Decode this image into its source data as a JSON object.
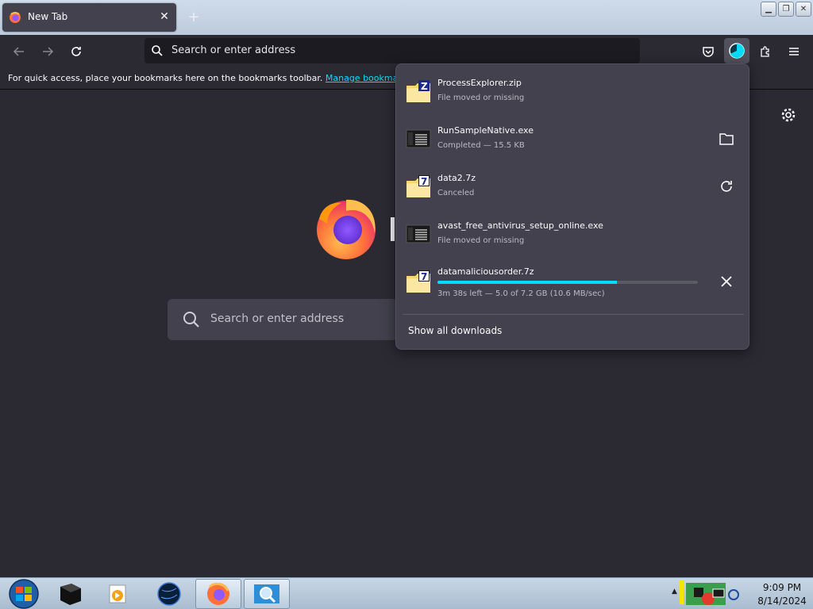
{
  "tab": {
    "title": "New Tab",
    "close_glyph": "✕"
  },
  "toolbar": {
    "new_tab_glyph": "+",
    "url_placeholder": "Search or enter address"
  },
  "bookmarks_bar": {
    "message": "For quick access, place your bookmarks here on the bookmarks toolbar.",
    "link": "Manage bookmarks…"
  },
  "new_tab_page": {
    "search_placeholder": "Search or enter address"
  },
  "downloads": {
    "items": [
      {
        "name": "ProcessExplorer.zip",
        "status": "File moved or missing",
        "icon": "zip-archive-icon",
        "action": ""
      },
      {
        "name": "RunSampleNative.exe",
        "status": "Completed — 15.5 KB",
        "icon": "executable-icon",
        "action": "folder-icon"
      },
      {
        "name": "data2.7z",
        "status": "Canceled",
        "icon": "7z-archive-icon",
        "action": "retry-icon"
      },
      {
        "name": "avast_free_antivirus_setup_online.exe",
        "status": "File moved or missing",
        "icon": "executable-icon",
        "action": ""
      },
      {
        "name": "datamaliciousorder.7z",
        "status": "3m 38s left — 5.0 of 7.2 GB (10.6 MB/sec)",
        "icon": "7z-archive-icon",
        "action": "cancel-icon",
        "progress": 0.69
      }
    ],
    "show_all": "Show all downloads"
  },
  "taskbar": {
    "time": "9:09 PM",
    "date": "8/14/2024"
  },
  "colors": {
    "accent": "#00ddff",
    "panel_bg": "#42414d",
    "page_bg": "#2b2a33"
  }
}
